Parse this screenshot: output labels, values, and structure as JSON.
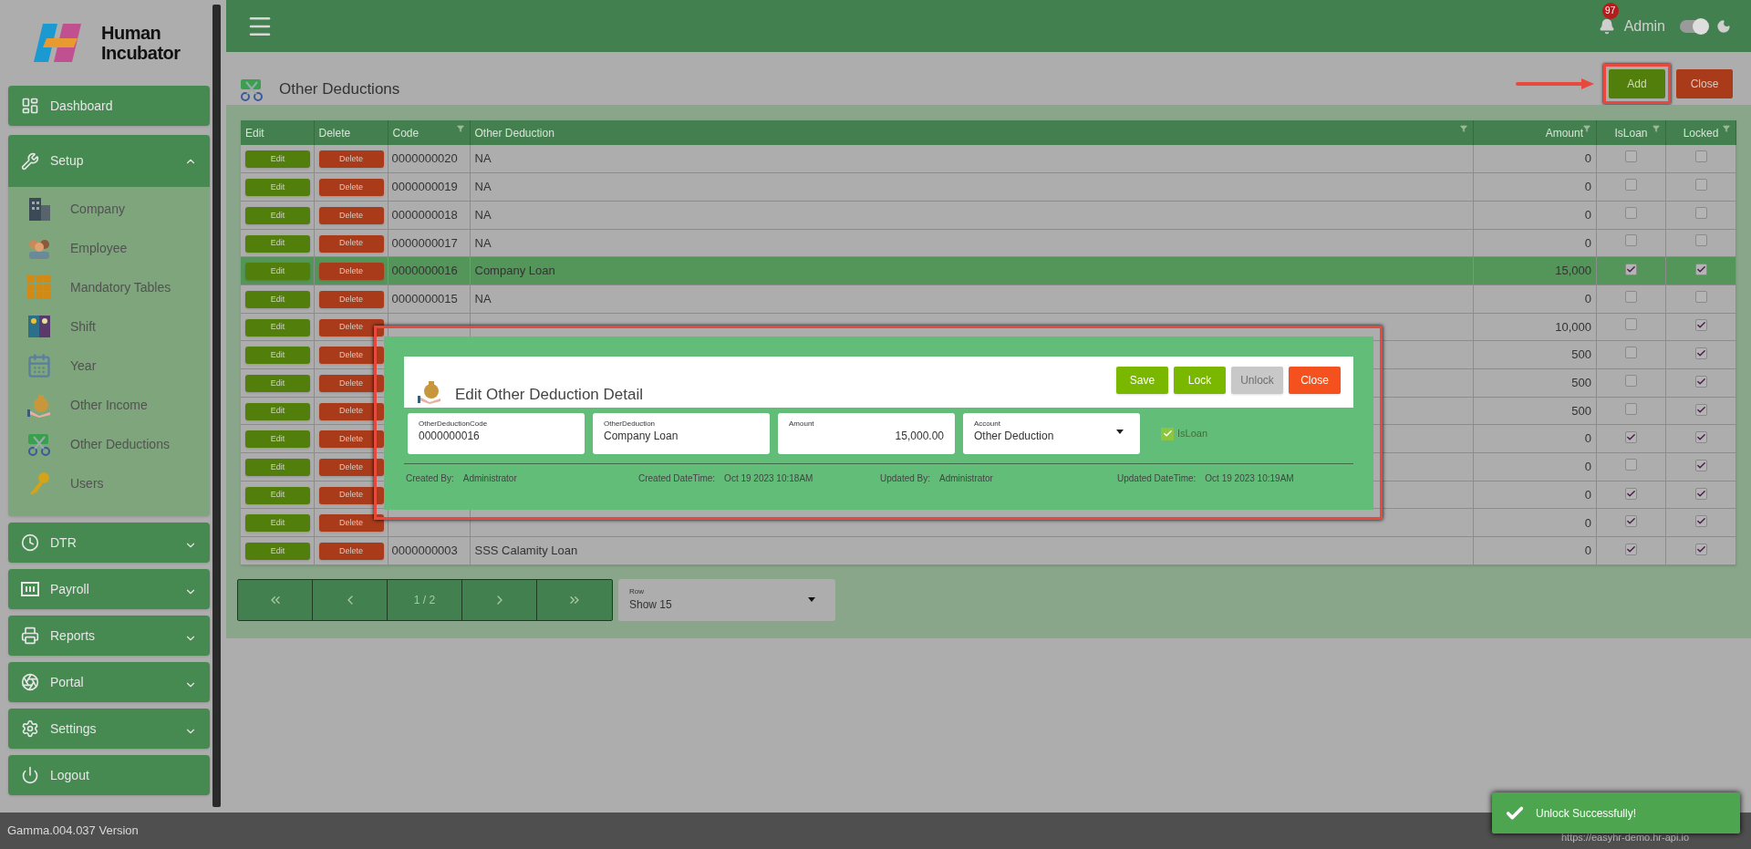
{
  "sidebar": {
    "logo": {
      "line1": "Human",
      "line2": "Incubator"
    },
    "items": [
      {
        "label": "Dashboard",
        "kind": "link"
      },
      {
        "label": "Setup",
        "kind": "group",
        "expanded": true,
        "children": [
          {
            "label": "Company"
          },
          {
            "label": "Employee"
          },
          {
            "label": "Mandatory Tables"
          },
          {
            "label": "Shift"
          },
          {
            "label": "Year"
          },
          {
            "label": "Other Income"
          },
          {
            "label": "Other Deductions"
          },
          {
            "label": "Users"
          }
        ]
      },
      {
        "label": "DTR",
        "kind": "group",
        "expanded": false
      },
      {
        "label": "Payroll",
        "kind": "group",
        "expanded": false
      },
      {
        "label": "Reports",
        "kind": "group",
        "expanded": false
      },
      {
        "label": "Portal",
        "kind": "group",
        "expanded": false
      },
      {
        "label": "Settings",
        "kind": "group",
        "expanded": false
      },
      {
        "label": "Logout",
        "kind": "link"
      }
    ]
  },
  "header": {
    "notifications": "97",
    "user": "Admin",
    "dark_mode": true
  },
  "page": {
    "title": "Other Deductions",
    "buttons": [
      {
        "label": "Add",
        "kind": "add",
        "highlighted": true
      },
      {
        "label": "Close",
        "kind": "close",
        "highlighted": false
      }
    ]
  },
  "table": {
    "columns": [
      {
        "label": "Edit",
        "filter": false
      },
      {
        "label": "Delete",
        "filter": false
      },
      {
        "label": "Code",
        "filter": true
      },
      {
        "label": "Other Deduction",
        "filter": true
      },
      {
        "label": "Amount",
        "filter": true
      },
      {
        "label": "IsLoan",
        "filter": true
      },
      {
        "label": "Locked",
        "filter": true
      }
    ],
    "rows": [
      {
        "edit": "Edit",
        "delete": "Delete",
        "code": "0000000020",
        "name": "NA",
        "amount": "0",
        "is_loan": false,
        "locked": false,
        "selected": false
      },
      {
        "edit": "Edit",
        "delete": "Delete",
        "code": "0000000019",
        "name": "NA",
        "amount": "0",
        "is_loan": false,
        "locked": false,
        "selected": false
      },
      {
        "edit": "Edit",
        "delete": "Delete",
        "code": "0000000018",
        "name": "NA",
        "amount": "0",
        "is_loan": false,
        "locked": false,
        "selected": false
      },
      {
        "edit": "Edit",
        "delete": "Delete",
        "code": "0000000017",
        "name": "NA",
        "amount": "0",
        "is_loan": false,
        "locked": false,
        "selected": false
      },
      {
        "edit": "Edit",
        "delete": "Delete",
        "code": "0000000016",
        "name": "Company Loan",
        "amount": "15,000",
        "is_loan": true,
        "locked": true,
        "selected": true
      },
      {
        "edit": "Edit",
        "delete": "Delete",
        "code": "0000000015",
        "name": "NA",
        "amount": "0",
        "is_loan": false,
        "locked": false,
        "selected": false
      },
      {
        "edit": "Edit",
        "delete": "Delete",
        "amount": "10,000",
        "is_loan": false,
        "locked": true,
        "selected": false
      },
      {
        "edit": "Edit",
        "delete": "Delete",
        "amount": "500",
        "is_loan": false,
        "locked": true,
        "selected": false
      },
      {
        "edit": "Edit",
        "delete": "Delete",
        "amount": "500",
        "is_loan": false,
        "locked": true,
        "selected": false
      },
      {
        "edit": "Edit",
        "delete": "Delete",
        "amount": "500",
        "is_loan": false,
        "locked": true,
        "selected": false
      },
      {
        "edit": "Edit",
        "delete": "Delete",
        "amount": "0",
        "is_loan": true,
        "locked": true,
        "selected": false
      },
      {
        "edit": "Edit",
        "delete": "Delete",
        "amount": "0",
        "is_loan": false,
        "locked": true,
        "selected": false
      },
      {
        "edit": "Edit",
        "delete": "Delete",
        "amount": "0",
        "is_loan": true,
        "locked": true,
        "selected": false
      },
      {
        "edit": "Edit",
        "delete": "Delete",
        "amount": "0",
        "is_loan": true,
        "locked": true,
        "selected": false
      },
      {
        "edit": "Edit",
        "delete": "Delete",
        "code": "0000000003",
        "name": "SSS Calamity Loan",
        "amount": "0",
        "is_loan": true,
        "locked": true,
        "selected": false
      }
    ]
  },
  "pagination": {
    "page": "1 / 2",
    "row_select": {
      "label": "Row",
      "value": "Show 15"
    }
  },
  "dialog": {
    "title": "Edit Other Deduction Detail",
    "buttons": [
      {
        "label": "Save",
        "kind": "save",
        "disabled": false
      },
      {
        "label": "Lock",
        "kind": "lock",
        "disabled": false
      },
      {
        "label": "Unlock",
        "kind": "unlock",
        "disabled": true
      },
      {
        "label": "Close",
        "kind": "close",
        "disabled": false
      }
    ],
    "fields": [
      {
        "kind": "text",
        "label": "OtherDeductionCode",
        "value": "0000000016"
      },
      {
        "kind": "text",
        "label": "OtherDeduction",
        "value": "Company Loan"
      },
      {
        "kind": "number",
        "label": "Amount",
        "value": "15,000.00"
      },
      {
        "kind": "select",
        "label": "Account",
        "value": "Other Deduction"
      },
      {
        "kind": "checkbox",
        "label": "IsLoan",
        "checked": true,
        "disabled": true
      }
    ],
    "audit": [
      {
        "label": "Created By:",
        "value": "Administrator"
      },
      {
        "label": "Created DateTime:",
        "value": "Oct 19 2023 10:18AM"
      },
      {
        "label": "Updated By:",
        "value": "Administrator"
      },
      {
        "label": "Updated DateTime:",
        "value": "Oct 19 2023 10:19AM"
      }
    ]
  },
  "toast": {
    "message": "Unlock Successfully!"
  },
  "footer": {
    "version": "Gamma.004.037 Version",
    "url": "https://easyhr-demo.hr-api.io"
  }
}
